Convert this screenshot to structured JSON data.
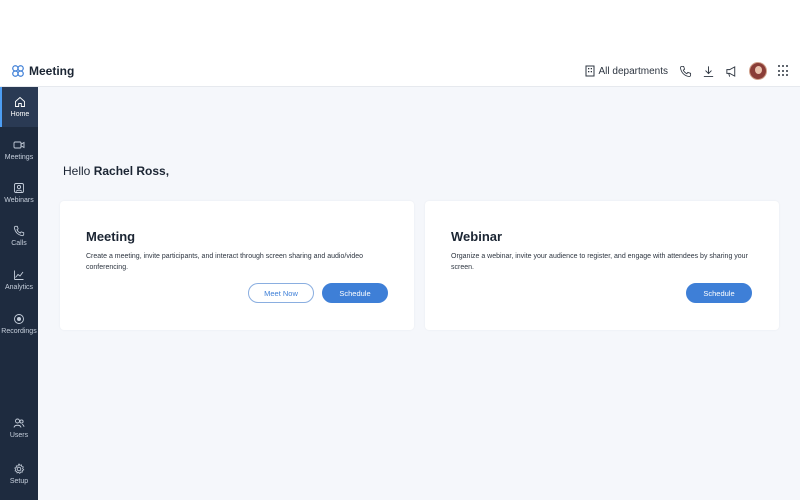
{
  "header": {
    "app_title": "Meeting",
    "department_label": "All departments",
    "icons": [
      "meeting-logo-icon",
      "building-icon",
      "phone-icon",
      "download-icon",
      "megaphone-icon",
      "avatar",
      "apps-grid-icon"
    ]
  },
  "sidebar": {
    "items": [
      {
        "label": "Home",
        "icon": "home-icon",
        "active": true
      },
      {
        "label": "Meetings",
        "icon": "video-icon",
        "active": false
      },
      {
        "label": "Webinars",
        "icon": "webinar-icon",
        "active": false
      },
      {
        "label": "Calls",
        "icon": "phone-icon",
        "active": false
      },
      {
        "label": "Analytics",
        "icon": "analytics-icon",
        "active": false
      },
      {
        "label": "Recordings",
        "icon": "record-icon",
        "active": false
      },
      {
        "label": "Users",
        "icon": "users-icon",
        "active": false
      },
      {
        "label": "Setup",
        "icon": "gear-icon",
        "active": false
      }
    ]
  },
  "main": {
    "greeting_prefix": "Hello",
    "user_name": "Rachel Ross,",
    "cards": [
      {
        "title": "Meeting",
        "description": "Create a meeting, invite participants, and interact through screen sharing and audio/video conferencing.",
        "secondary_button": "Meet Now",
        "primary_button": "Schedule"
      },
      {
        "title": "Webinar",
        "description": "Organize a webinar, invite your audience to register, and engage with attendees by sharing your screen.",
        "primary_button": "Schedule"
      }
    ]
  },
  "colors": {
    "sidebar_bg": "#1e2b3f",
    "accent": "#3e7fd7",
    "main_bg": "#f5f7fb"
  }
}
